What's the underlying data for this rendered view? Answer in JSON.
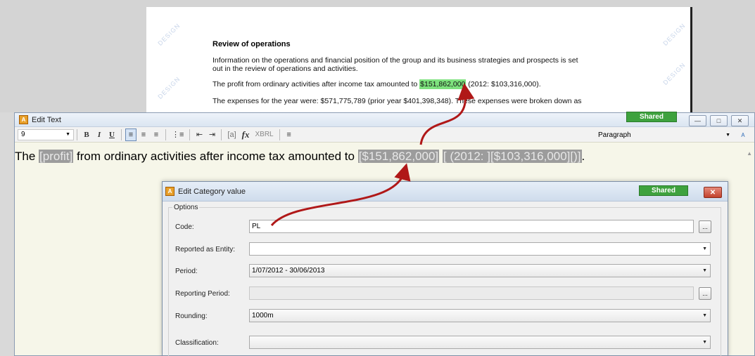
{
  "document": {
    "heading": "Review of operations",
    "para1_line1": "Information on the operations and financial position of the group and its business strategies and prospects is set",
    "para1_line2": "out in the review of operations and activities.",
    "para2_before": "The profit from ordinary activities after income tax amounted to ",
    "para2_highlight": "$151,862,000",
    "para2_after": " (2012: $103,316,000).",
    "para3": "The expenses for the year were: $571,775,789 (prior year $401,398,348). These expenses were broken down as",
    "watermark": "DESIGN"
  },
  "edit_text": {
    "title": "Edit Text",
    "shared_label": "Shared",
    "font_size": "9",
    "bold": "B",
    "italic": "I",
    "underline": "U",
    "bracket_tag": "[a]",
    "fx": "fx",
    "xbrl": "XBRL",
    "paragraph_style": "Paragraph",
    "content": {
      "t1": "The ",
      "tag1": "[profit]",
      "t2": " from ordinary activities after income tax amounted to ",
      "tag2": "[$151,862,000]",
      "t3": " ",
      "tag3": "[ (2012: ][$103,316,000][)]",
      "t4": "."
    }
  },
  "dialog": {
    "title": "Edit Category value",
    "shared_label": "Shared",
    "options_legend": "Options",
    "code_label": "Code:",
    "code_value": "PL",
    "reported_label": "Reported as Entity:",
    "reported_value": "",
    "period_label": "Period:",
    "period_value": "1/07/2012 - 30/06/2013",
    "reporting_period_label": "Reporting Period:",
    "reporting_period_value": "",
    "rounding_label": "Rounding:",
    "rounding_value": "1000m",
    "classification_label": "Classification:",
    "classification_value": "",
    "ellipsis": "..."
  },
  "colors": {
    "highlight_green": "#7ee27e",
    "shared_green": "#3ea23e",
    "arrow_red": "#b01818",
    "tag_gray": "#9c9c9c"
  }
}
